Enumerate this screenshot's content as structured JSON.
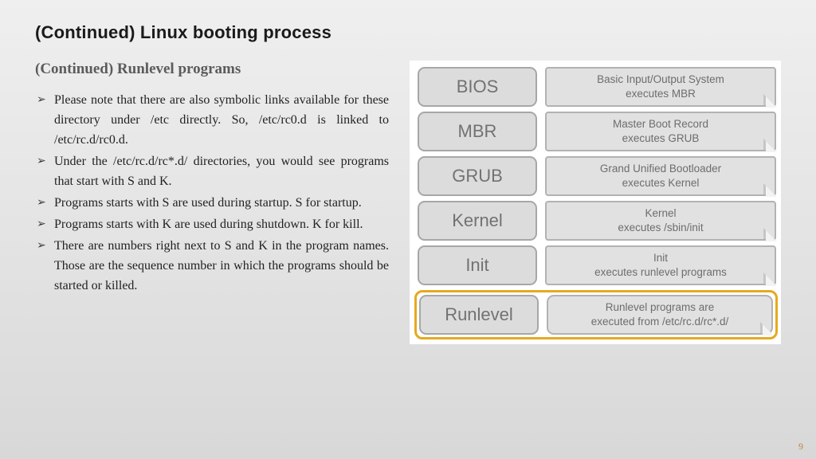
{
  "title": "(Continued) Linux booting process",
  "subtitle": "(Continued) Runlevel programs",
  "bullets": [
    "Please note that there are also symbolic links available for these directory under /etc directly. So, /etc/rc0.d is linked to /etc/rc.d/rc0.d.",
    "Under the /etc/rc.d/rc*.d/ directories, you would see programs that start with S and K.",
    "Programs starts with S are used during startup. S for startup.",
    "Programs starts with K are used during shutdown. K for kill.",
    "There are numbers right next to S and K in the program names. Those are the sequence number in which the programs should be started or killed."
  ],
  "stages": [
    {
      "name": "BIOS",
      "desc_l1": "Basic Input/Output System",
      "desc_l2": "executes MBR",
      "highlight": false
    },
    {
      "name": "MBR",
      "desc_l1": "Master Boot Record",
      "desc_l2": "executes GRUB",
      "highlight": false
    },
    {
      "name": "GRUB",
      "desc_l1": "Grand Unified Bootloader",
      "desc_l2": "executes Kernel",
      "highlight": false
    },
    {
      "name": "Kernel",
      "desc_l1": "Kernel",
      "desc_l2": "executes /sbin/init",
      "highlight": false
    },
    {
      "name": "Init",
      "desc_l1": "Init",
      "desc_l2": "executes runlevel programs",
      "highlight": false
    },
    {
      "name": "Runlevel",
      "desc_l1": "Runlevel programs are",
      "desc_l2": "executed from /etc/rc.d/rc*.d/",
      "highlight": true
    }
  ],
  "page_number": "9"
}
